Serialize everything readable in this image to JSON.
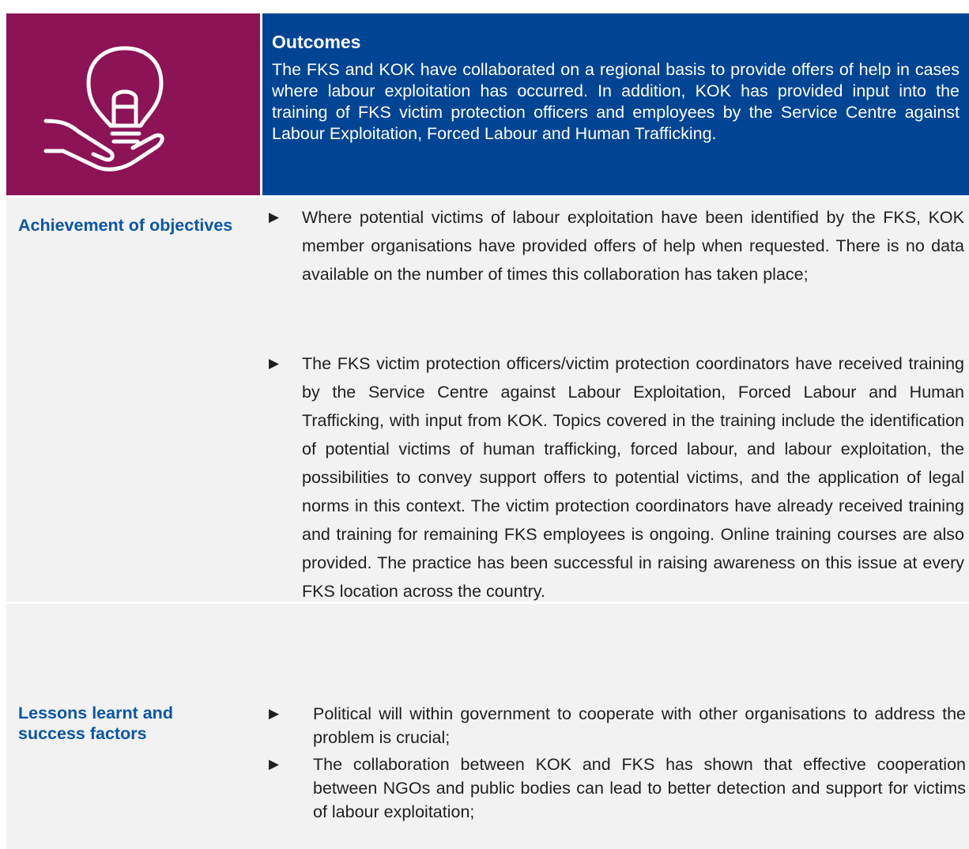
{
  "outcomes": {
    "title": "Outcomes",
    "text": "The FKS and KOK have collaborated on a regional basis to provide offers of help in cases where labour exploitation has occurred. In addition, KOK has provided input into the training of FKS victim protection officers and employees by the Service Centre against Labour Exploitation, Forced Labour and Human Trafficking."
  },
  "achievement": {
    "label": "Achievement of objectives",
    "bullets": [
      "Where potential victims of labour exploitation have been identified by the FKS, KOK member organisations have provided offers of help when requested. There is no data available on the number of times this collaboration has taken place;",
      "The FKS victim protection officers/victim protection coordinators have received training by the Service Centre against Labour Exploitation, Forced Labour and Human Trafficking, with input from KOK. Topics covered in the training include the identification of potential victims of human trafficking, forced labour, and labour exploitation, the possibilities to convey support offers to potential victims, and the application of legal norms in this context. The victim protection coordinators have already received training and training for remaining FKS employees is ongoing. Online training courses are also provided. The practice has been successful in raising awareness on this issue at every FKS location across the country."
    ]
  },
  "lessons": {
    "label": "Lessons learnt and success factors",
    "bullets": [
      "Political will within government to cooperate with other organisations to address the problem is crucial;",
      "The collaboration between KOK and FKS has shown that effective cooperation between NGOs and public bodies can lead to better detection and support for victims of labour exploitation;"
    ]
  },
  "bullet_glyph": "▶",
  "colors": {
    "icon_panel": "#8b1356",
    "outcomes_panel": "#004494",
    "label_text": "#0b57a4",
    "row_background": "#f2f2f2"
  },
  "icons": [
    "lightbulb-in-hand-icon"
  ]
}
